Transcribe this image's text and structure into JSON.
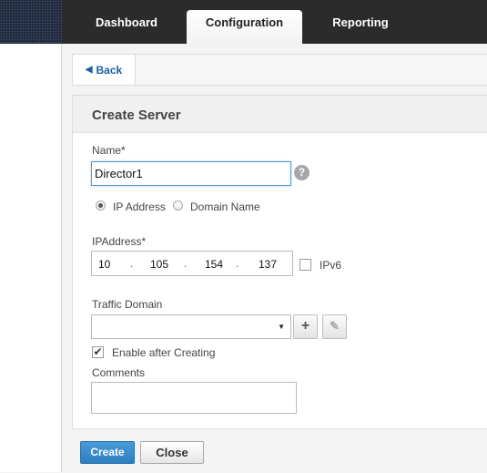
{
  "nav": {
    "tabs": [
      {
        "label": "Dashboard",
        "active": false
      },
      {
        "label": "Configuration",
        "active": true
      },
      {
        "label": "Reporting",
        "active": false
      }
    ]
  },
  "back": {
    "label": "Back",
    "icon": "arrow-left-icon"
  },
  "panel": {
    "title": "Create Server"
  },
  "form": {
    "name_label": "Name*",
    "name_value": "Director1",
    "help_glyph": "?",
    "radio_ip_label": "IP Address",
    "radio_domain_label": "Domain Name",
    "selected_address_type": "IP Address",
    "ipaddress_label": "IPAddress*",
    "ip_octets": [
      "10",
      "105",
      "154",
      "137"
    ],
    "ip_separator": ".",
    "ipv6_label": "IPv6",
    "ipv6_checked": false,
    "traffic_domain_label": "Traffic Domain",
    "traffic_domain_value": "",
    "add_glyph": "+",
    "edit_glyph": "✎",
    "enable_after_creating_label": "Enable after Creating",
    "enable_after_creating_checked": true,
    "checkmark_glyph": "✔",
    "comments_label": "Comments",
    "comments_value": ""
  },
  "footer": {
    "create_label": "Create",
    "close_label": "Close"
  },
  "colors": {
    "accent": "#2d7fc1",
    "topbar": "#2b2b2b",
    "link": "#1a5fa3"
  }
}
